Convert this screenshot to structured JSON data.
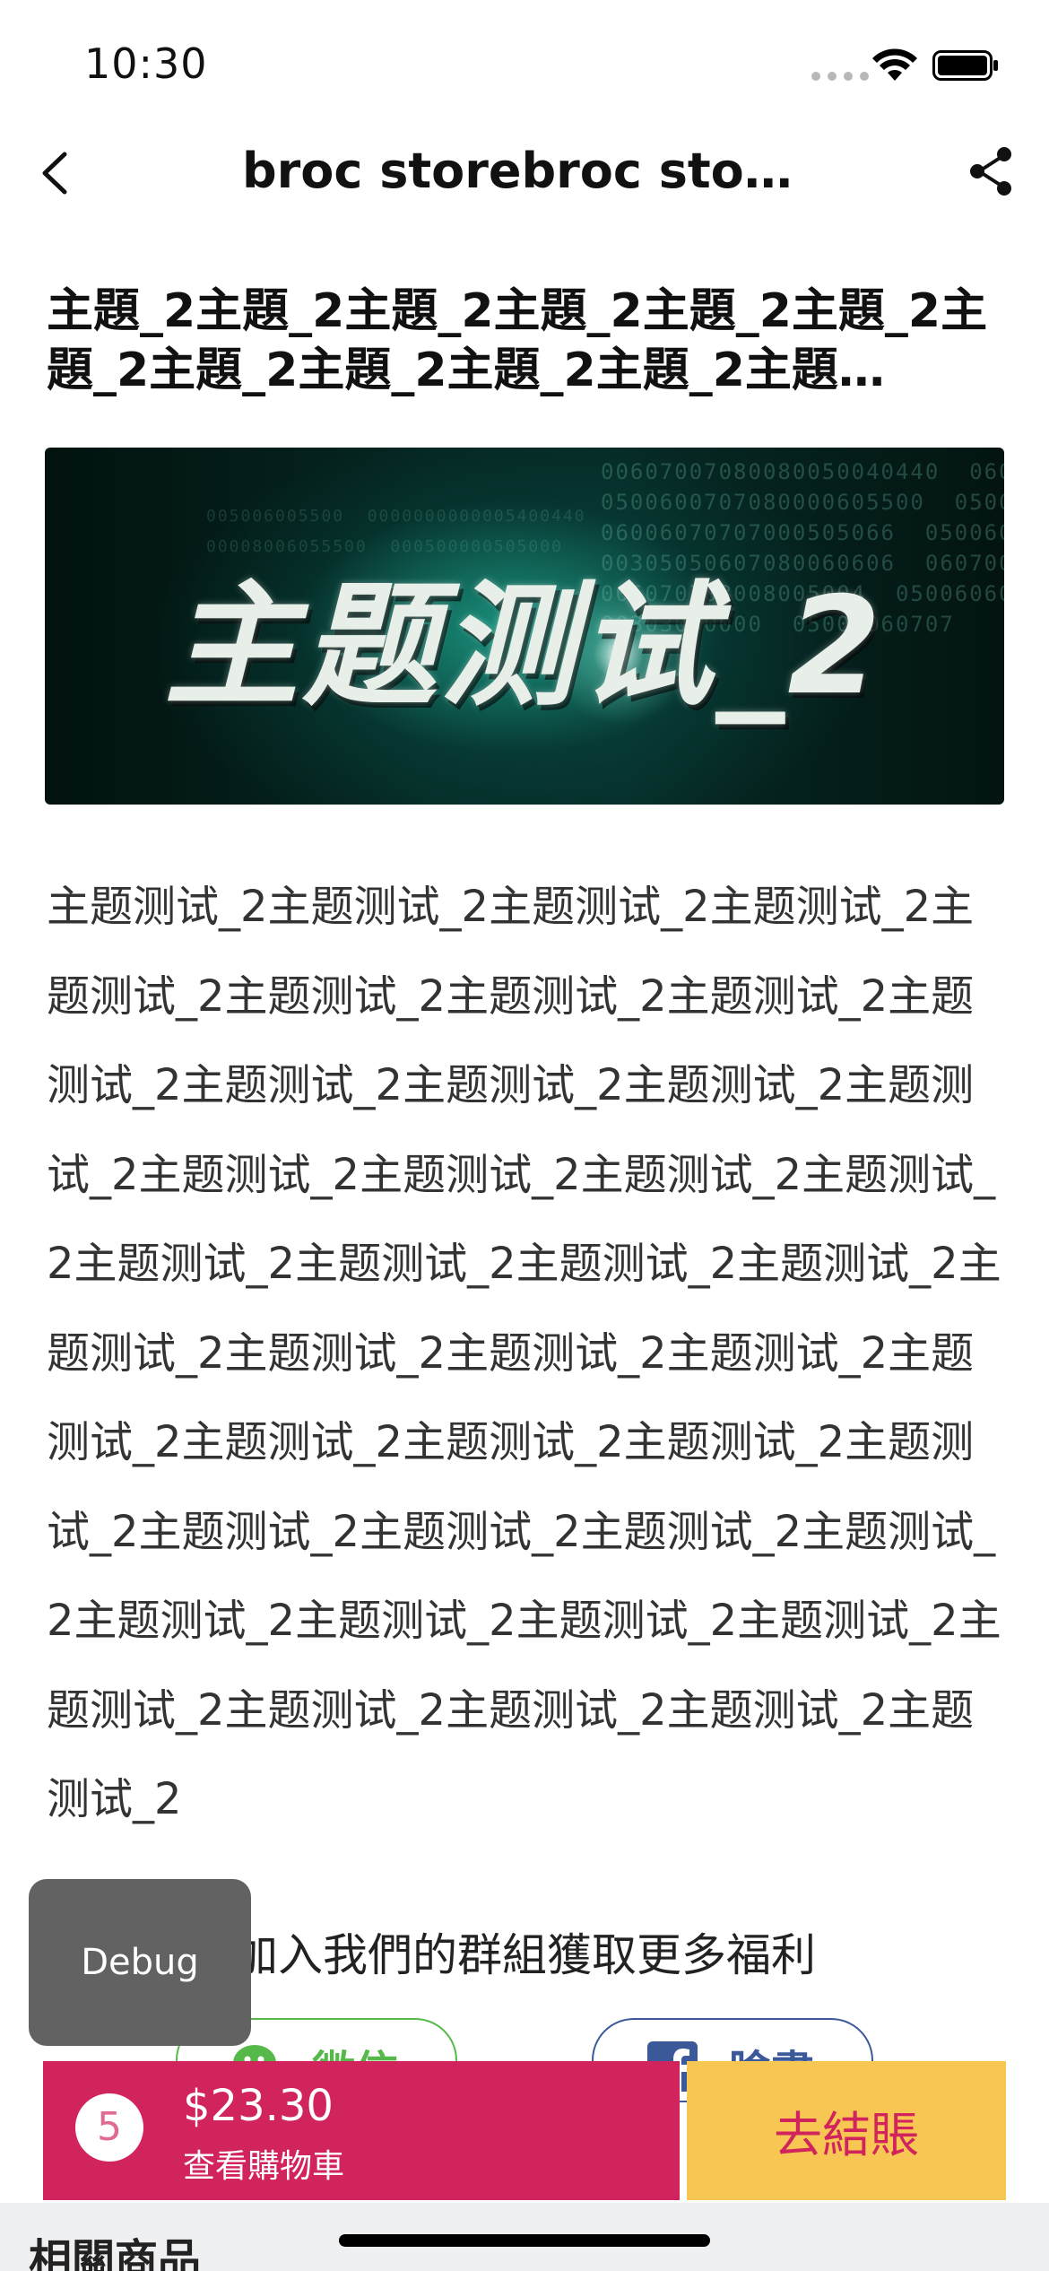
{
  "status_bar": {
    "time": "10:30"
  },
  "nav": {
    "title": "broc storebroc store…",
    "back_icon": "chevron-left-icon",
    "share_icon": "share-icon"
  },
  "article": {
    "title": "主題_2主題_2主題_2主題_2主題_2主題_2主題_2主題_2主題_2主題_2主題_2主題…",
    "banner_text": "主题测试_2",
    "body": "主题测试_2主题测试_2主题测试_2主题测试_2主题测试_2主题测试_2主题测试_2主题测试_2主题测试_2主题测试_2主题测试_2主题测试_2主题测试_2主题测试_2主题测试_2主题测试_2主题测试_2主题测试_2主题测试_2主题测试_2主题测试_2主题测试_2主题测试_2主题测试_2主题测试_2主题测试_2主题测试_2主题测试_2主题测试_2主题测试_2主题测试_2主题测试_2主题测试_2主题测试_2主题测试_2主题测试_2主题测试_2主题测试_2主题测试_2主题测试_2主题测试_2主题测试_2主题测试_2"
  },
  "group": {
    "heading": "加入我們的群組獲取更多福利",
    "wechat_label": "微信",
    "facebook_label": "臉書"
  },
  "debug": {
    "label": "Debug"
  },
  "cart": {
    "count": "5",
    "total": "$23.30",
    "view_label": "查看購物車",
    "checkout_label": "去結賬"
  },
  "related": {
    "title": "相關商品"
  },
  "colors": {
    "cart_bg": "#d1245d",
    "checkout_bg": "#f7c653",
    "wechat": "#55b94a",
    "facebook": "#3b5998"
  }
}
